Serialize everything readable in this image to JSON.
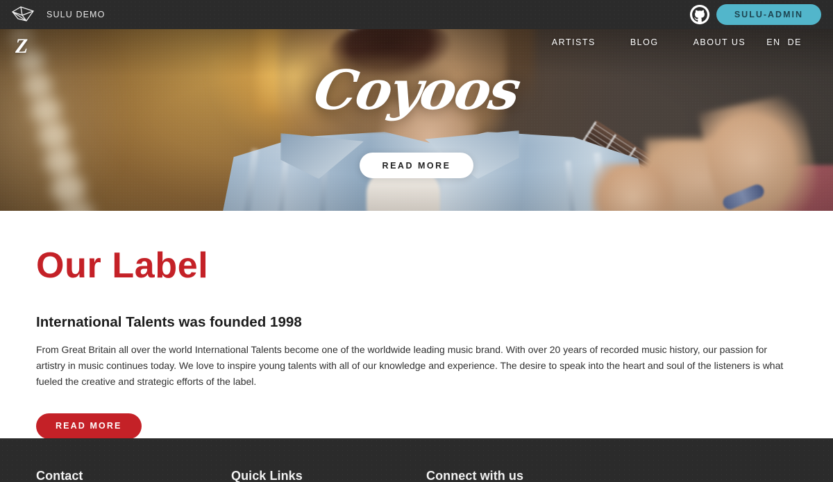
{
  "admin_bar": {
    "logo_icon": "sulu-cube-icon",
    "brand_name": "SULU DEMO",
    "github_icon": "github-icon",
    "admin_button_label": "SULU-ADMIN",
    "admin_button_color": "#52b6cb",
    "background_color": "#2b2b2b"
  },
  "hero": {
    "site_logo_text": "Z",
    "nav": [
      {
        "label": "ARTISTS"
      },
      {
        "label": "BLOG"
      },
      {
        "label": "ABOUT US"
      }
    ],
    "languages": [
      {
        "label": "EN"
      },
      {
        "label": "DE"
      }
    ],
    "title": "Coyoos",
    "cta_label": "READ MORE"
  },
  "main": {
    "section_title": "Our Label",
    "section_title_color": "#c42127",
    "subtitle": "International Talents was founded 1998",
    "body": "From Great Britain all over the world International Talents become one of the worldwide leading music brand. With over 20 years of recorded music history, our passion for artistry in music continues today. We love to inspire young talents with all of our knowledge and experience. The desire to speak into the heart and soul of the listeners is what fueled the creative and strategic efforts of the label.",
    "cta_label": "READ MORE",
    "cta_color": "#c42127"
  },
  "footer": {
    "background_color": "#2b2b2b",
    "columns": [
      {
        "heading": "Contact"
      },
      {
        "heading": "Quick Links"
      },
      {
        "heading": "Connect with us"
      }
    ]
  }
}
